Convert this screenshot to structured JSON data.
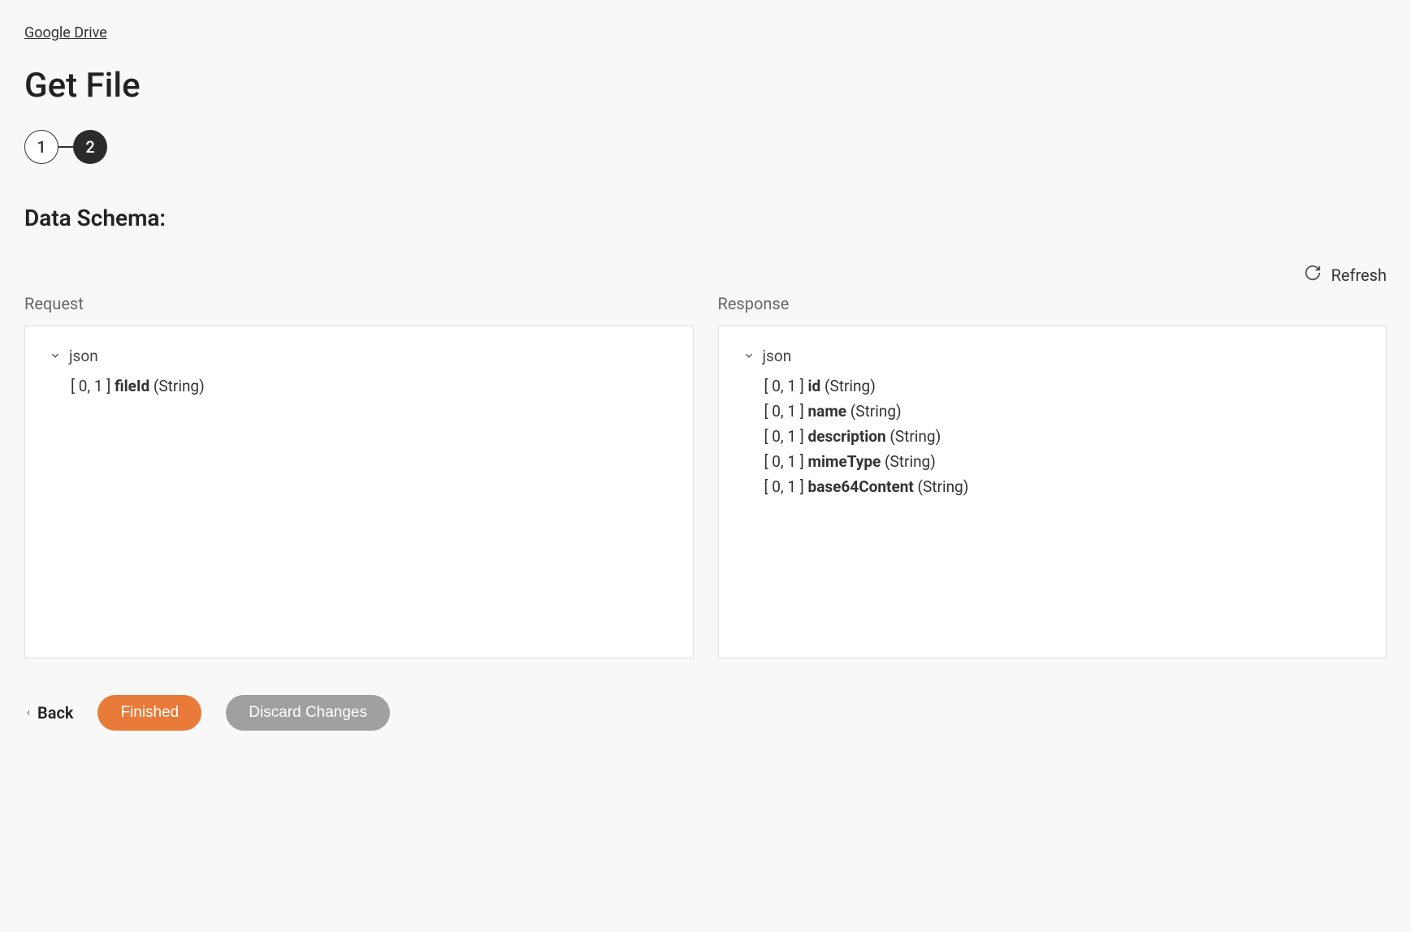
{
  "breadcrumb": "Google Drive",
  "pageTitle": "Get File",
  "stepper": {
    "step1": "1",
    "step2": "2"
  },
  "sectionTitle": "Data Schema:",
  "refreshLabel": "Refresh",
  "request": {
    "label": "Request",
    "root": "json",
    "fields": [
      {
        "cardinality": "[ 0, 1 ]",
        "name": "fileId",
        "type": "(String)"
      }
    ]
  },
  "response": {
    "label": "Response",
    "root": "json",
    "fields": [
      {
        "cardinality": "[ 0, 1 ]",
        "name": "id",
        "type": "(String)"
      },
      {
        "cardinality": "[ 0, 1 ]",
        "name": "name",
        "type": "(String)"
      },
      {
        "cardinality": "[ 0, 1 ]",
        "name": "description",
        "type": "(String)"
      },
      {
        "cardinality": "[ 0, 1 ]",
        "name": "mimeType",
        "type": "(String)"
      },
      {
        "cardinality": "[ 0, 1 ]",
        "name": "base64Content",
        "type": "(String)"
      }
    ]
  },
  "footer": {
    "back": "Back",
    "finished": "Finished",
    "discard": "Discard Changes"
  }
}
